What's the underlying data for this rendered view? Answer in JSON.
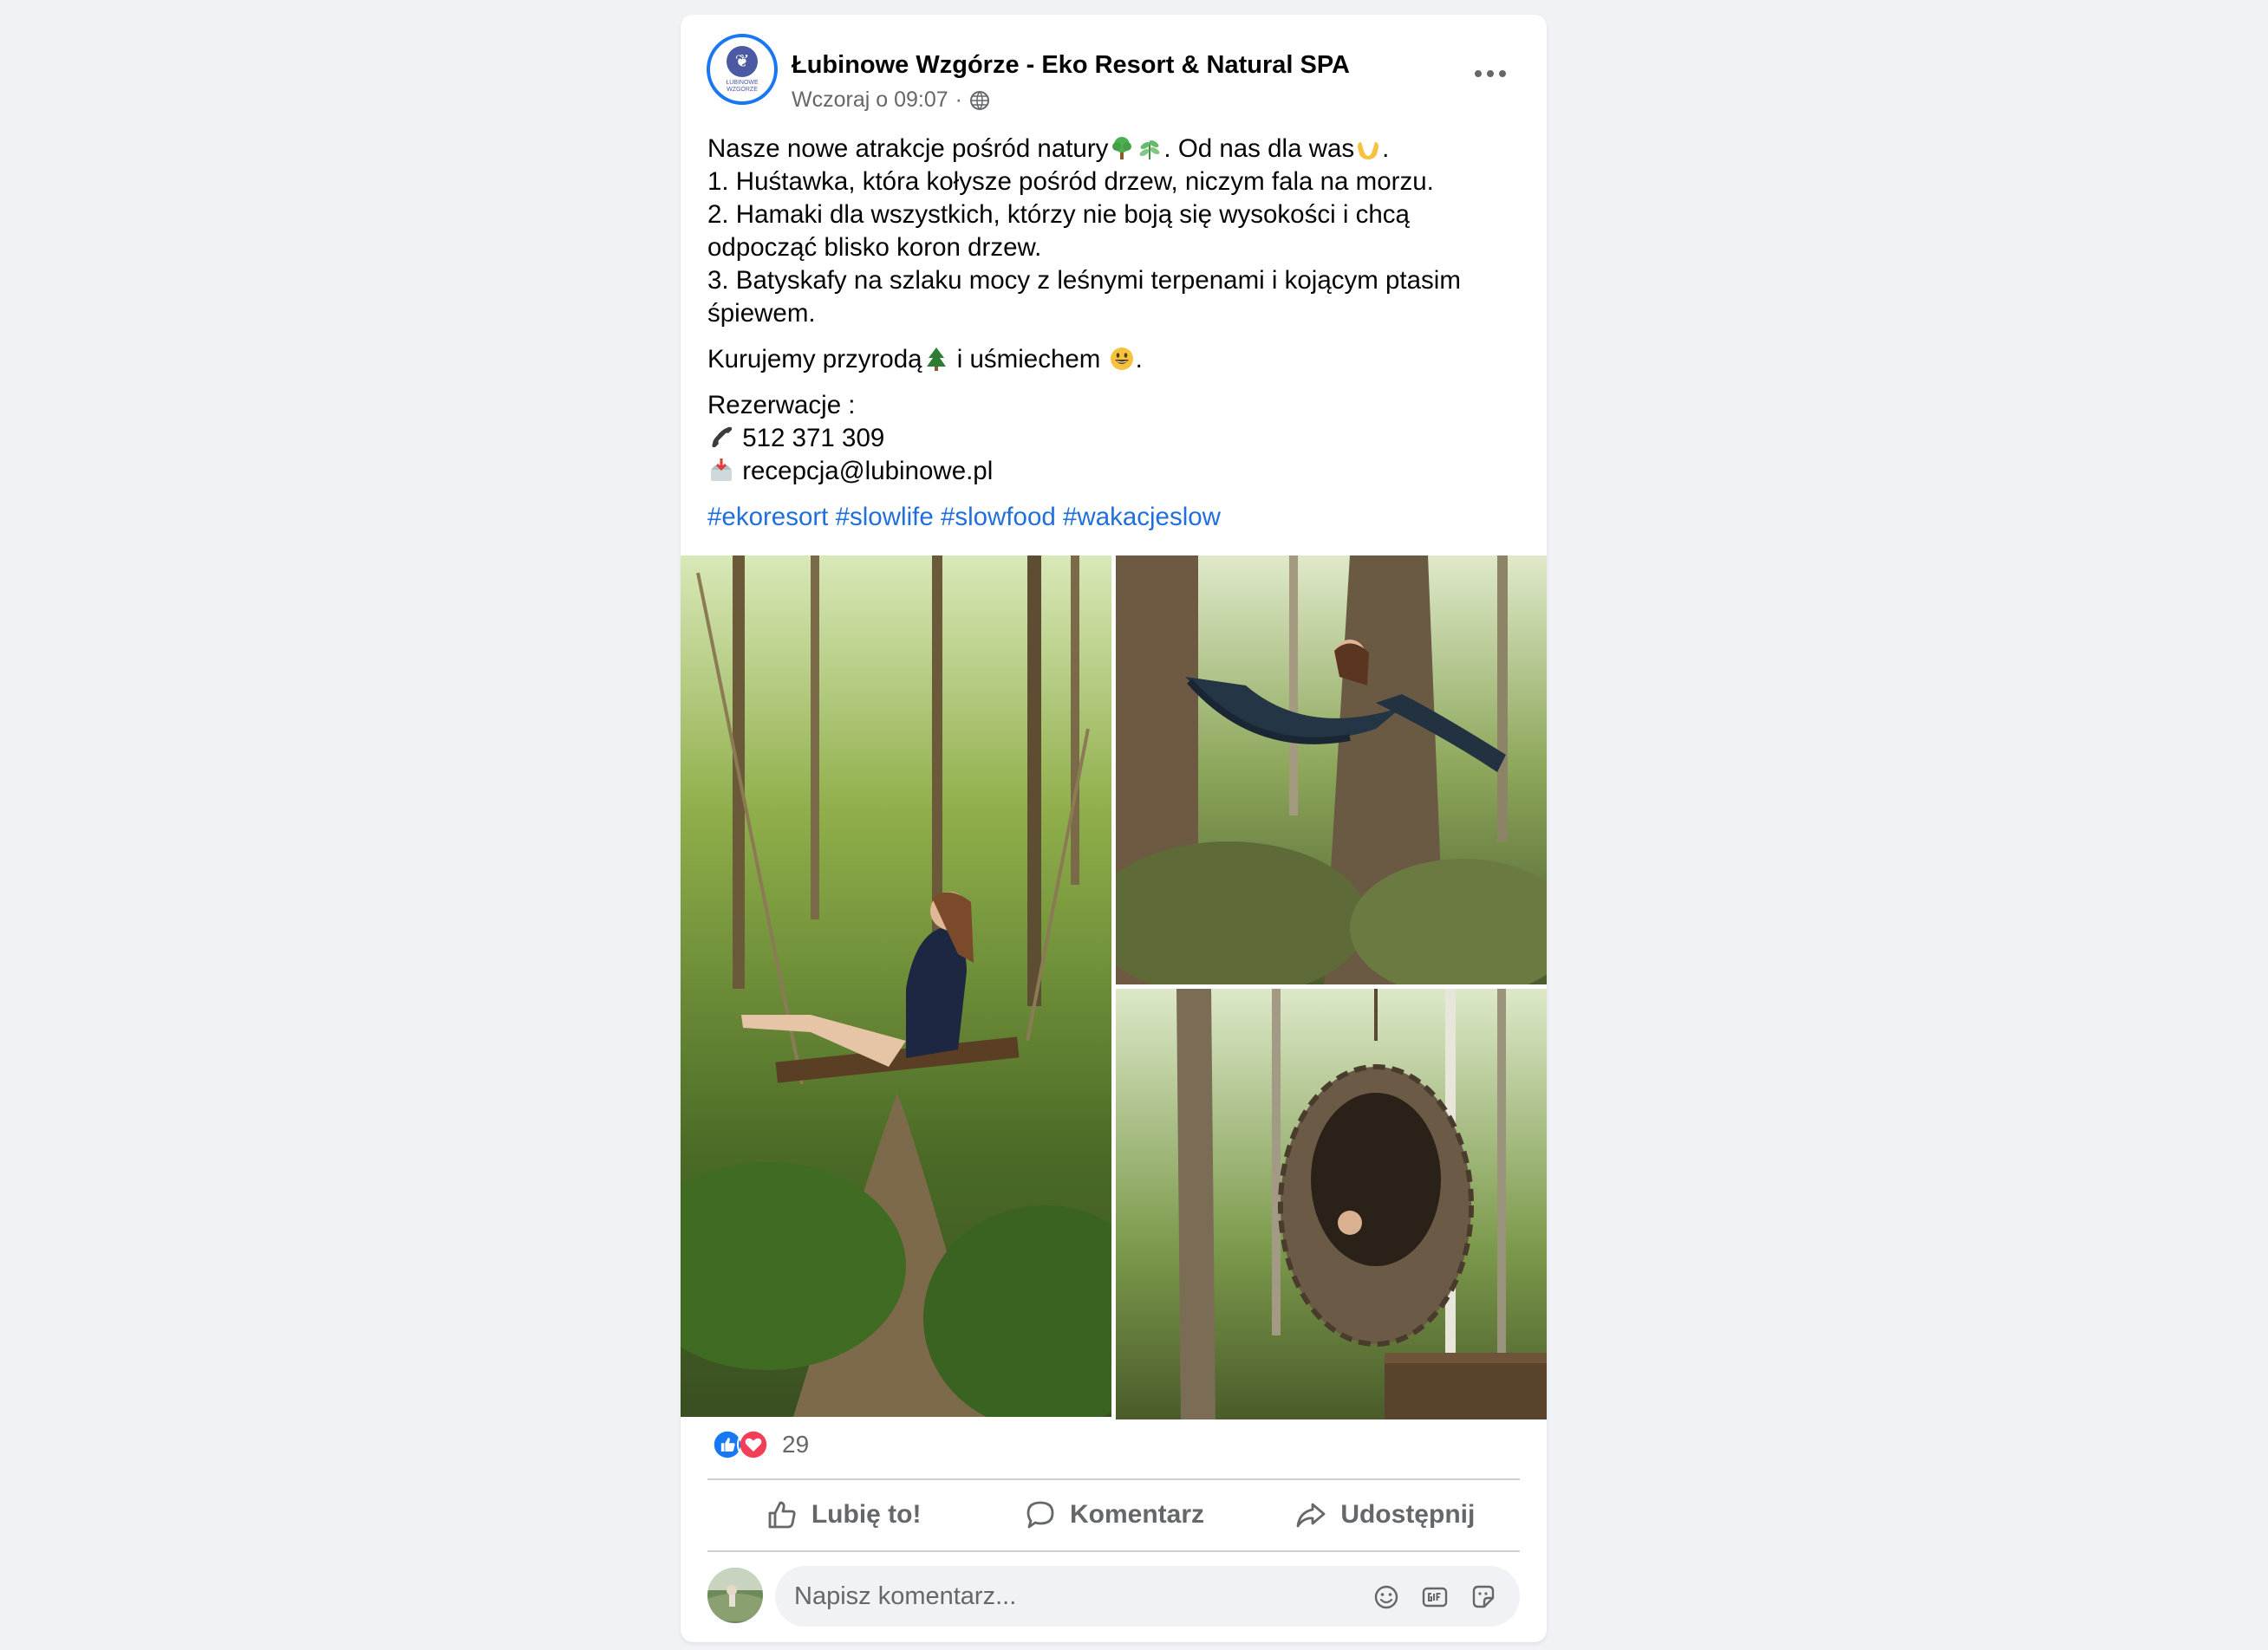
{
  "post": {
    "page_name": "Łubinowe Wzgórze - Eko Resort & Natural SPA",
    "avatar_text": "ŁUBINOWE WZGÓRZE",
    "timestamp": "Wczoraj o 09:07",
    "separator": "·",
    "audience_icon": "globe-icon",
    "menu_icon": "more-options-icon",
    "text": {
      "line1_a": "Nasze nowe atrakcje pośród natury",
      "line1_b": ". Od nas dla was",
      "line1_c": ".",
      "line2": "1. Huśtawka, która kołysze pośród drzew, niczym fala na morzu.",
      "line3": "2. Hamaki dla wszystkich, którzy nie boją się wysokości i chcą odpocząć blisko koron drzew.",
      "line4": "3. Batyskafy na szlaku mocy z leśnymi terpenami i kojącym ptasim śpiewem.",
      "para2_a": "Kurujemy przyrodą",
      "para2_b": " i uśmiechem ",
      "para2_c": ".",
      "contact_label": "Rezerwacje :",
      "phone": "512 371 309",
      "email": "recepcja@lubinowe.pl"
    },
    "hashtags": [
      "#ekoresort",
      "#slowlife",
      "#slowfood",
      "#wakacjeslow"
    ],
    "photos": [
      {
        "name": "photo-swing",
        "subject": "woman on a wooden swing in forest"
      },
      {
        "name": "photo-hammock",
        "subject": "woman in a hammock between trees"
      },
      {
        "name": "photo-nest",
        "subject": "woven wicker nest hanging in forest"
      }
    ],
    "reactions": {
      "icons": [
        "like-reaction-icon",
        "love-reaction-icon"
      ],
      "count": "29"
    },
    "actions": {
      "like": "Lubię to!",
      "comment": "Komentarz",
      "share": "Udostępnij"
    },
    "composer": {
      "placeholder": "Napisz komentarz...",
      "icons": [
        "emoji-icon",
        "gif-icon",
        "sticker-icon"
      ]
    }
  },
  "colors": {
    "background": "#f0f2f5",
    "card": "#ffffff",
    "link": "#216fdb",
    "secondary_text": "#65676b",
    "brand_blue": "#1877f2",
    "love_red": "#f33e58"
  }
}
